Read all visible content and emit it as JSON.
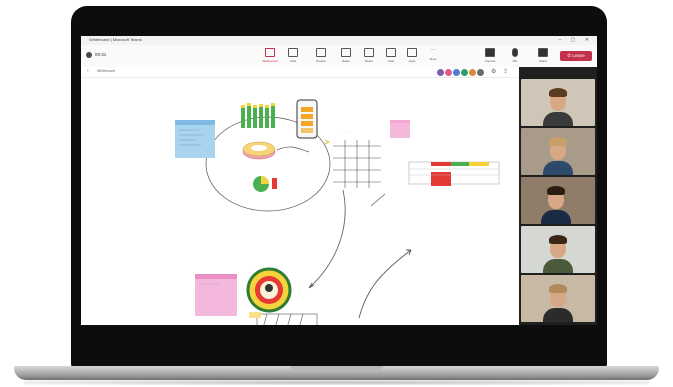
{
  "window": {
    "title": "Whiteboard | Microsoft Teams",
    "controls": "– ▢ ✕"
  },
  "toolbar": {
    "timer": "00:31",
    "buttons": [
      {
        "label": "Whiteboard",
        "icon": "whiteboard-icon",
        "active": true
      },
      {
        "label": "Chat",
        "icon": "chat-icon",
        "active": false
      },
      {
        "label": "People",
        "icon": "people-icon",
        "active": false
      },
      {
        "label": "Raise",
        "icon": "raise-hand-icon",
        "active": false
      },
      {
        "label": "React",
        "icon": "react-icon",
        "active": false
      },
      {
        "label": "View",
        "icon": "view-icon",
        "active": false
      },
      {
        "label": "Apps",
        "icon": "apps-icon",
        "active": false
      },
      {
        "label": "More",
        "icon": "more-icon",
        "active": false
      },
      {
        "label": "Camera",
        "icon": "camera-icon",
        "active": false
      },
      {
        "label": "Mic",
        "icon": "mic-icon",
        "active": false
      },
      {
        "label": "Share",
        "icon": "share-icon",
        "active": false
      }
    ],
    "leave_label": "Leave"
  },
  "whiteboard_bar": {
    "name": "Whiteboard",
    "zoom": "",
    "avatar_colors": [
      "#7b5ea7",
      "#e05b8c",
      "#4c7bd9",
      "#2f9e6e",
      "#d98b3a",
      "#6a6a6a"
    ]
  },
  "participants": [
    {
      "name": "",
      "shirt": "#3a3a3a",
      "bg": "#cfc6b8"
    },
    {
      "name": "",
      "shirt": "#2d4a6b",
      "bg": "#a89b8a"
    },
    {
      "name": "",
      "shirt": "#1b2b44",
      "bg": "#8f7d6a"
    },
    {
      "name": "",
      "shirt": "#4a5a3a",
      "bg": "#d4d7d2"
    },
    {
      "name": "",
      "shirt": "#2b2b2b",
      "bg": "#c7b9a3"
    }
  ],
  "colors": {
    "accent": "#c4314b",
    "sticky_blue": "#a9d4ef",
    "sticky_pink": "#f3b8dc",
    "sticky_pink2": "#f2a8d3",
    "green": "#4caf50",
    "red": "#e53935",
    "yellow": "#f5d33b"
  }
}
